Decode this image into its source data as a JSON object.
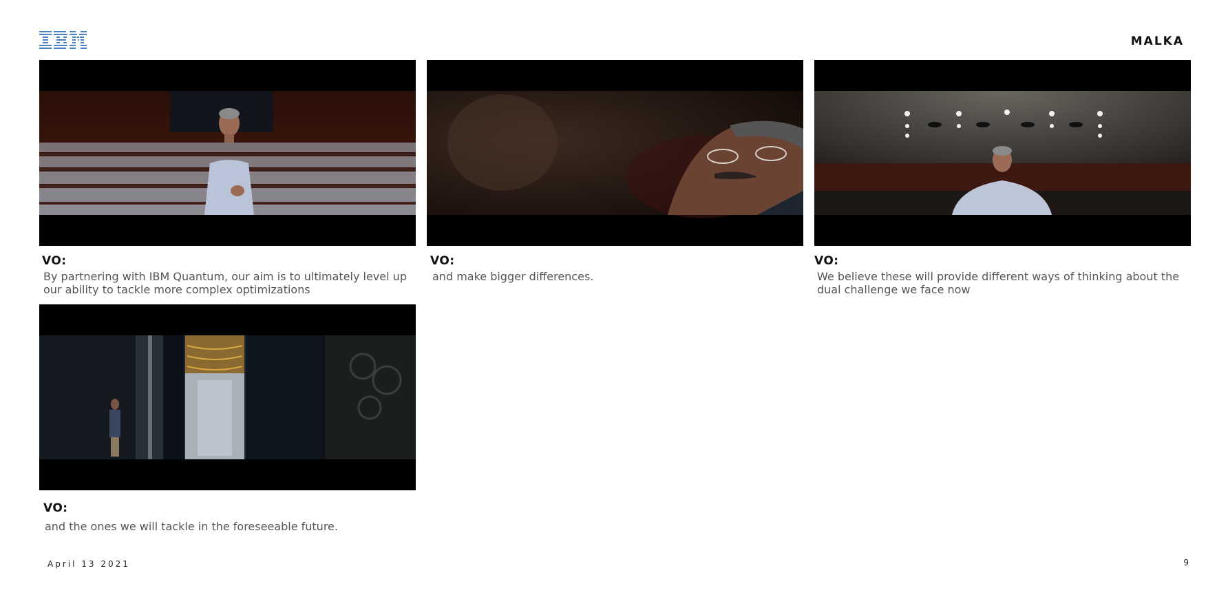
{
  "header": {
    "brand": "MALKA"
  },
  "logo": {
    "icon": "ibm-logo-icon",
    "color": "#4a7fc1",
    "text": "IBM"
  },
  "panels": [
    {
      "label": "VO:",
      "text": "By partnering with IBM Quantum, our aim is to ultimately level up our ability to tackle more complex optimizations",
      "still": "speaker-in-auditorium-wide"
    },
    {
      "label": "VO:",
      "text": "and make bigger differences.",
      "still": "speaker-closeup"
    },
    {
      "label": "VO:",
      "text": "We believe these will provide different ways of thinking about the dual challenge we face now",
      "still": "speaker-under-ceiling-lights"
    },
    {
      "label": "VO:",
      "text": "and the ones we will tackle in the foreseeable future.",
      "still": "quantum-computer-lab"
    }
  ],
  "footer": {
    "date": "April 13 2021",
    "page_number": "9"
  }
}
